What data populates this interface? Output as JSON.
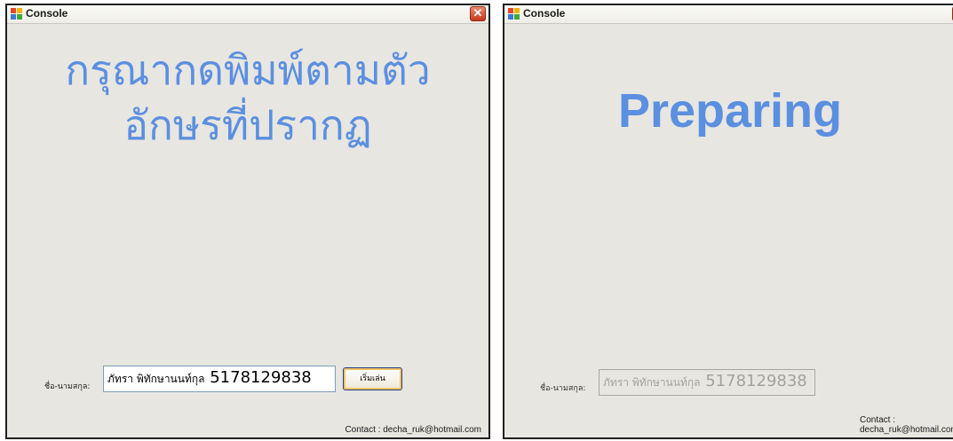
{
  "left_window": {
    "title": "Console",
    "close_symbol": "✕",
    "message_line1": "กรุณากดพิมพ์ตามตัว",
    "message_line2": "อักษรที่ปรากฏ",
    "name_label": "ชื่อ-นามสกุล:",
    "name_value_thai": "ภัทรา พิทักษานนท์กุล",
    "name_value_id": "5178129838",
    "start_button": "เริ่มเล่น",
    "contact": "Contact : decha_ruk@hotmail.com"
  },
  "right_window": {
    "title": "Console",
    "close_symbol": "✕",
    "message": "Preparing",
    "name_label": "ชื่อ-นามสกุล:",
    "name_value_thai": "ภัทรา พิทักษานนท์กุล",
    "name_value_id": "5178129838",
    "contact": "Contact : decha_ruk@hotmail.com"
  },
  "colors": {
    "message": "#5b8fe0",
    "window_bg": "#e7e6e1",
    "close_button": "#c8381a"
  },
  "icons": {
    "app": "form-app-icon",
    "close": "close-icon"
  }
}
